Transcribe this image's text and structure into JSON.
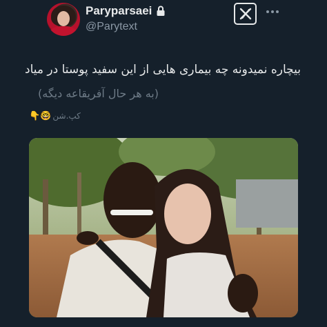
{
  "author": {
    "display_name": "Paryparsaei",
    "handle": "@Parytext",
    "protected": true
  },
  "icons": {
    "avatar": "profile-photo",
    "lock": "lock-icon",
    "logo": "x-logo",
    "more": "more-icon"
  },
  "tweet": {
    "text": "بیچاره نمیدونه چه بیماری هایی از این سفید پوستا در میاد",
    "subtext": "(به هر حال آفریقاعه دیگه)"
  },
  "caption": {
    "text": "کپ.شن",
    "emojis": "👇🤓"
  },
  "colors": {
    "background": "#15202b",
    "primary_text": "#e7e9ea",
    "secondary_text": "#8b98a5"
  }
}
